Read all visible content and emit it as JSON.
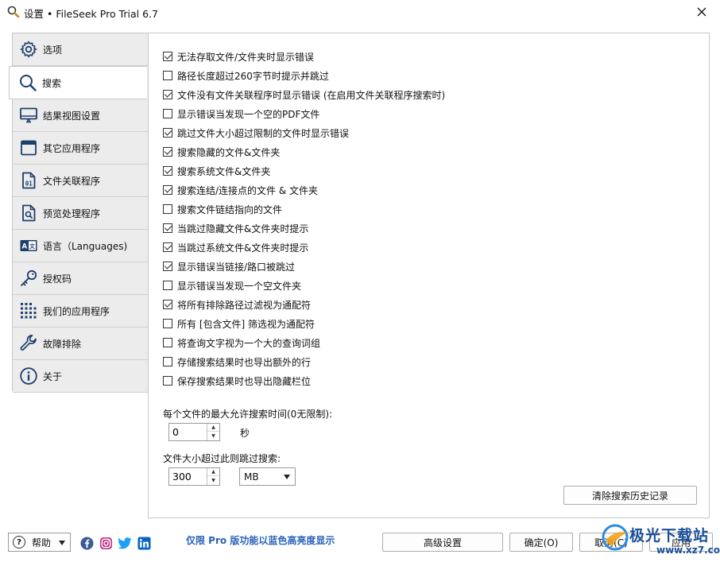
{
  "window": {
    "title": "设置 • FileSeek Pro Trial 6.7"
  },
  "sidebar": {
    "items": [
      {
        "label": "选项",
        "icon": "gear-icon",
        "active": false
      },
      {
        "label": "搜索",
        "icon": "search-icon",
        "active": true
      },
      {
        "label": "结果视图设置",
        "icon": "monitor-icon",
        "active": false
      },
      {
        "label": "其它应用程序",
        "icon": "window-icon",
        "active": false
      },
      {
        "label": "文件关联程序",
        "icon": "file-binary-icon",
        "active": false
      },
      {
        "label": "预览处理程序",
        "icon": "file-search-icon",
        "active": false
      },
      {
        "label": "语言（Languages)",
        "icon": "language-icon",
        "active": false
      },
      {
        "label": "授权码",
        "icon": "key-icon",
        "active": false
      },
      {
        "label": "我们的应用程序",
        "icon": "apps-grid-icon",
        "active": false
      },
      {
        "label": "故障排除",
        "icon": "wrench-icon",
        "active": false
      },
      {
        "label": "关于",
        "icon": "info-icon",
        "active": false
      }
    ]
  },
  "options": [
    {
      "label": "无法存取文件/文件夹时显示错误",
      "checked": true
    },
    {
      "label": "路径长度超过260字节时提示并跳过",
      "checked": false
    },
    {
      "label": "文件没有文件关联程序时显示错误 (在启用文件关联程序搜索时)",
      "checked": true
    },
    {
      "label": "显示错误当发现一个空的PDF文件",
      "checked": false
    },
    {
      "label": "跳过文件大小超过限制的文件时显示错误",
      "checked": true
    },
    {
      "label": "搜索隐藏的文件&文件夹",
      "checked": true
    },
    {
      "label": "搜索系统文件&文件夹",
      "checked": true
    },
    {
      "label": "搜索连结/连接点的文件 & 文件夹",
      "checked": true
    },
    {
      "label": "搜索文件链结指向的文件",
      "checked": false
    },
    {
      "label": "当跳过隐藏文件&文件夹时提示",
      "checked": true
    },
    {
      "label": "当跳过系统文件&文件夹时提示",
      "checked": true
    },
    {
      "label": "显示错误当链接/路口被跳过",
      "checked": true
    },
    {
      "label": "显示错误当发现一个空文件夹",
      "checked": false
    },
    {
      "label": "将所有排除路径过滤视为通配符",
      "checked": true
    },
    {
      "label": "所有 [包含文件] 筛选视为通配符",
      "checked": false
    },
    {
      "label": "将查询文字视为一个大的查询词组",
      "checked": false
    },
    {
      "label": "存储搜索结果时也导出额外的行",
      "checked": false
    },
    {
      "label": "保存搜索结果时也导出隐藏栏位",
      "checked": false
    }
  ],
  "time_limit": {
    "label": "每个文件的最大允许搜索时间(0无限制):",
    "value": "0",
    "unit": "秒"
  },
  "size_limit": {
    "label": "文件大小超过此则跳过搜索:",
    "value": "300",
    "unit": "MB"
  },
  "clear_history_label": "清除搜索历史记录",
  "footer": {
    "help_label": "帮助",
    "pro_note": "仅限 Pro 版功能以蓝色高亮度显示",
    "advanced_label": "高级设置",
    "ok_label": "确定(O)",
    "cancel_label": "取消(C)",
    "apply_label": "应用"
  },
  "watermark": {
    "text": "极光下载站",
    "url": "www.xz7.com"
  },
  "colors": {
    "pro_blue": "#2a62b8",
    "facebook": "#3b5998",
    "instagram": "#c13584",
    "twitter": "#1da1f2",
    "linkedin": "#0a66c2"
  }
}
